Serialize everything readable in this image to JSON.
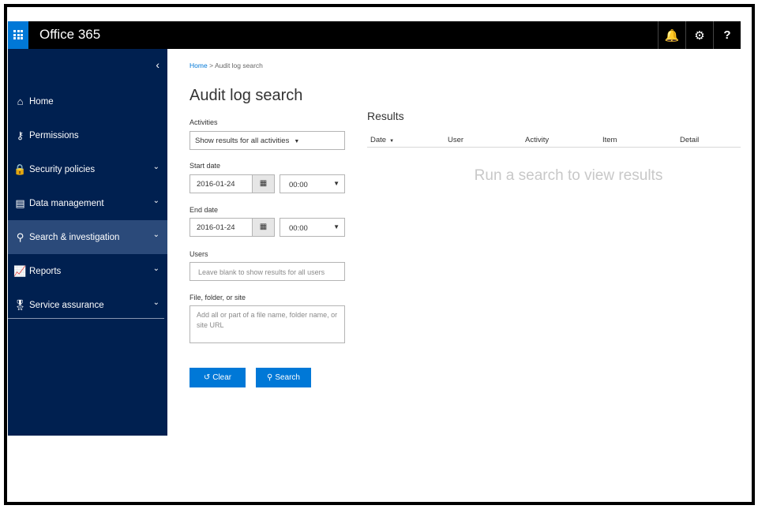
{
  "app": {
    "title": "Office 365"
  },
  "topbar": {
    "icons": [
      {
        "name": "bell-icon",
        "glyph": "🔔"
      },
      {
        "name": "gear-icon",
        "glyph": "⚙"
      },
      {
        "name": "help-icon",
        "glyph": "?"
      }
    ]
  },
  "sidebar": {
    "collapse_glyph": "‹",
    "items": [
      {
        "label": "Home",
        "icon": "⌂"
      },
      {
        "label": "Permissions",
        "icon": "⚷"
      },
      {
        "label": "Security policies",
        "icon": "🔒"
      },
      {
        "label": "Data management",
        "icon": "▤"
      },
      {
        "label": "Search & investigation",
        "icon": "⚲"
      },
      {
        "label": "Reports",
        "icon": "📈"
      },
      {
        "label": "Service assurance",
        "icon": "🎖"
      }
    ],
    "chevron": "⌄"
  },
  "breadcrumb": {
    "home": "Home",
    "sep": ">",
    "current": "Audit log search"
  },
  "page": {
    "title": "Audit log search"
  },
  "form": {
    "activities_label": "Activities",
    "activities_value": "Show results for all activities",
    "start_label": "Start date",
    "start_date": "2016-01-24",
    "start_time": "00:00",
    "end_label": "End date",
    "end_date": "2016-01-24",
    "end_time": "00:00",
    "users_label": "Users",
    "users_placeholder": "Leave blank to show results for all users",
    "file_label": "File, folder, or site",
    "file_placeholder": "Add all or part of a file name, folder name, or site URL",
    "clear_label": "Clear",
    "search_label": "Search"
  },
  "results": {
    "title": "Results",
    "columns": [
      "Date",
      "User",
      "Activity",
      "Item",
      "Detail"
    ],
    "empty_message": "Run a search to view results"
  },
  "colors": {
    "accent": "#0078d7",
    "sidebar": "#002050",
    "sidebar_active": "#2b4a7a",
    "topbar": "#000000"
  }
}
